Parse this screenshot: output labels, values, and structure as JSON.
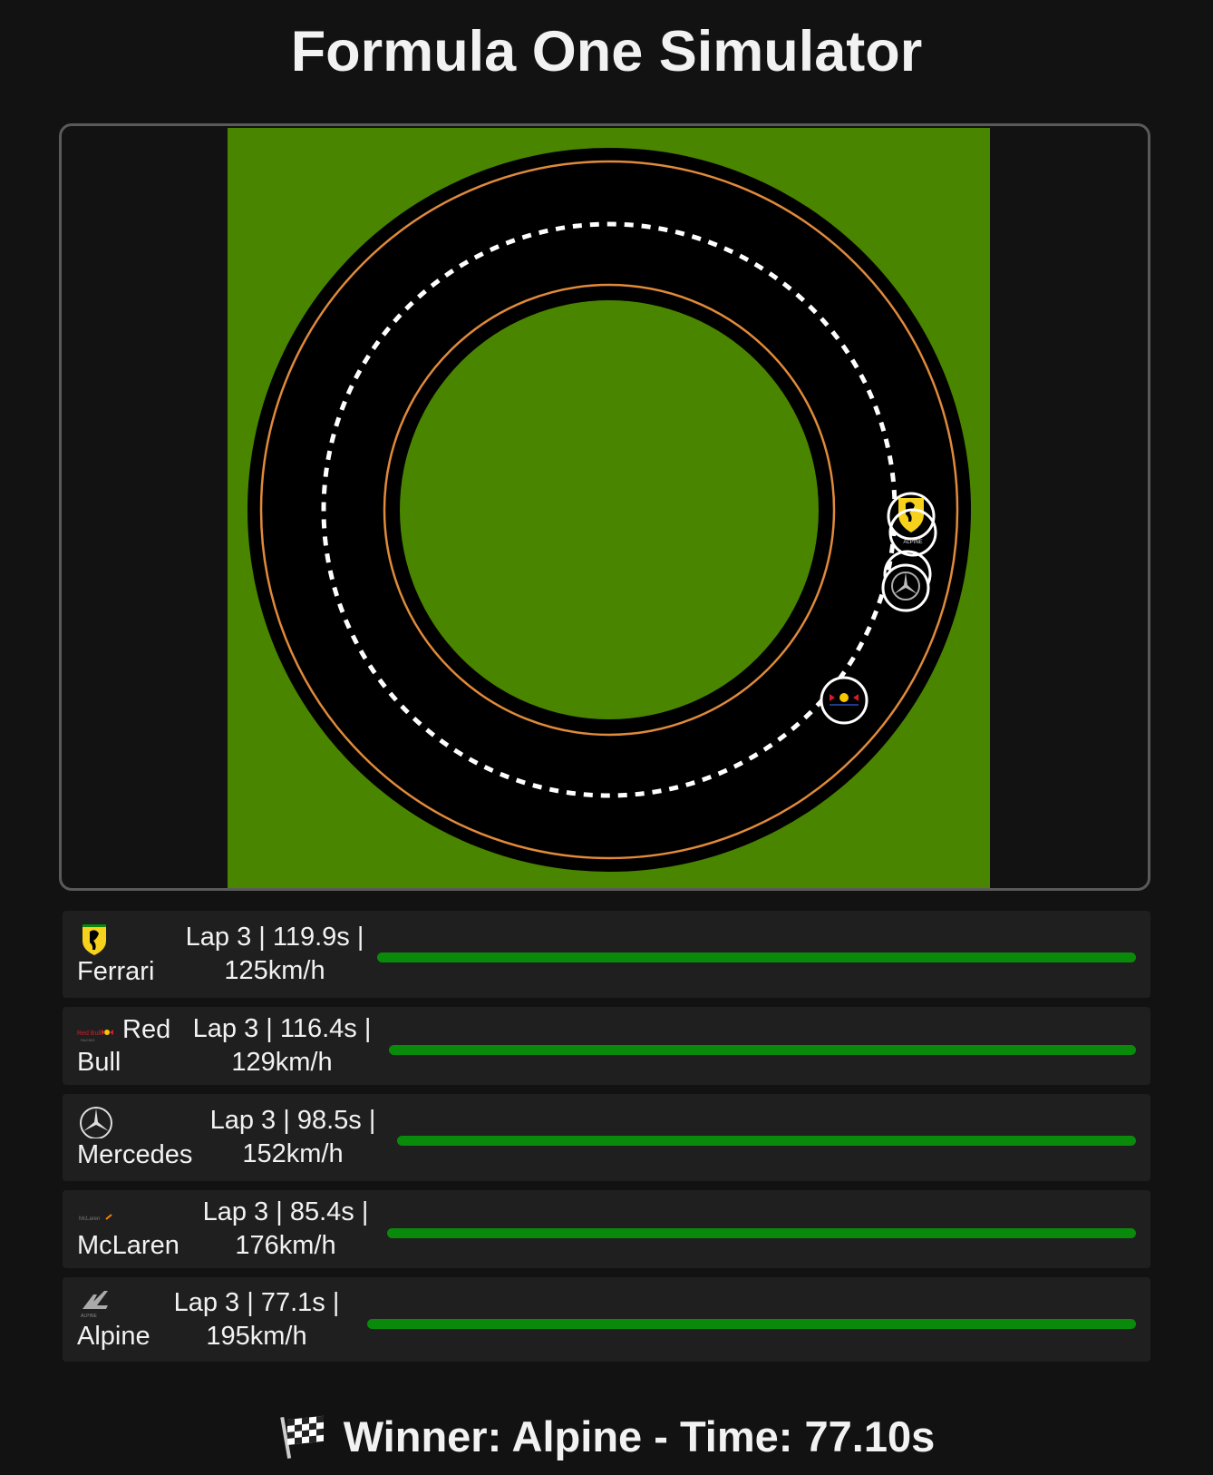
{
  "app": {
    "title": "Formula One Simulator"
  },
  "track": {
    "grass_color": "#4a8500",
    "asphalt_color": "#000000",
    "edge_line_color": "#e08a3a",
    "center_line_color": "#ffffff",
    "cars_on_track": [
      {
        "team": "Ferrari",
        "icon": "ferrari-logo-icon"
      },
      {
        "team": "Alpine",
        "icon": "alpine-logo-icon"
      },
      {
        "team": "McLaren",
        "icon": "mclaren-logo-icon"
      },
      {
        "team": "Mercedes",
        "icon": "mercedes-logo-icon"
      },
      {
        "team": "Red Bull",
        "icon": "redbull-logo-icon"
      }
    ]
  },
  "standings": [
    {
      "team": "Ferrari",
      "icon": "ferrari-logo-icon",
      "stats": "Lap 3 | 119.9s | 125km/h",
      "progress": 1.0
    },
    {
      "team": "Red Bull",
      "icon": "redbull-logo-icon",
      "stats": "Lap 3 | 116.4s | 129km/h",
      "progress": 1.0
    },
    {
      "team": "Mercedes",
      "icon": "mercedes-logo-icon",
      "stats": "Lap 3 | 98.5s | 152km/h",
      "progress": 1.0
    },
    {
      "team": "McLaren",
      "icon": "mclaren-logo-icon",
      "stats": "Lap 3 | 85.4s | 176km/h",
      "progress": 1.0
    },
    {
      "team": "Alpine",
      "icon": "alpine-logo-icon",
      "stats": "Lap 3 | 77.1s | 195km/h",
      "progress": 1.0
    }
  ],
  "progress_color": "#0a8a0a",
  "result": {
    "icon": "checkered-flag-icon",
    "text": "Winner: Alpine - Time: 77.10s"
  }
}
